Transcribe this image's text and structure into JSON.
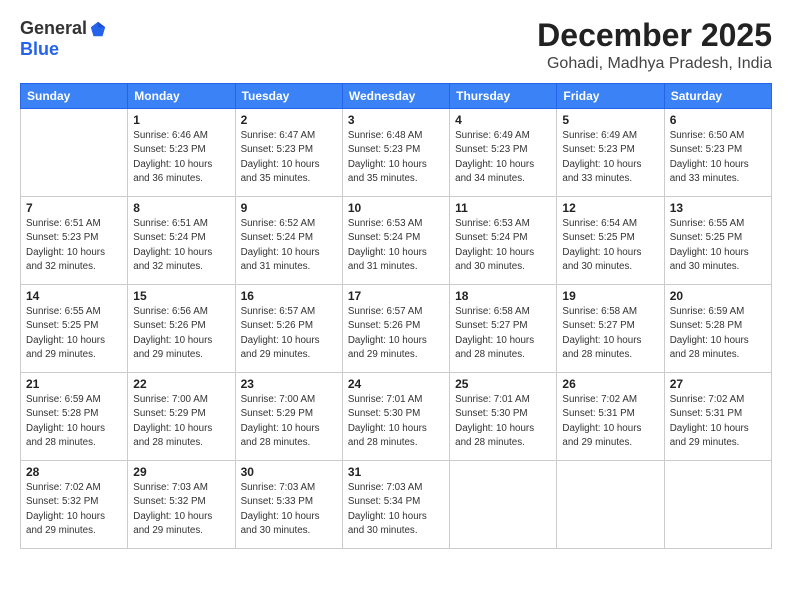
{
  "logo": {
    "general": "General",
    "blue": "Blue"
  },
  "title": "December 2025",
  "subtitle": "Gohadi, Madhya Pradesh, India",
  "days_header": [
    "Sunday",
    "Monday",
    "Tuesday",
    "Wednesday",
    "Thursday",
    "Friday",
    "Saturday"
  ],
  "weeks": [
    [
      {
        "day": "",
        "info": ""
      },
      {
        "day": "1",
        "info": "Sunrise: 6:46 AM\nSunset: 5:23 PM\nDaylight: 10 hours\nand 36 minutes."
      },
      {
        "day": "2",
        "info": "Sunrise: 6:47 AM\nSunset: 5:23 PM\nDaylight: 10 hours\nand 35 minutes."
      },
      {
        "day": "3",
        "info": "Sunrise: 6:48 AM\nSunset: 5:23 PM\nDaylight: 10 hours\nand 35 minutes."
      },
      {
        "day": "4",
        "info": "Sunrise: 6:49 AM\nSunset: 5:23 PM\nDaylight: 10 hours\nand 34 minutes."
      },
      {
        "day": "5",
        "info": "Sunrise: 6:49 AM\nSunset: 5:23 PM\nDaylight: 10 hours\nand 33 minutes."
      },
      {
        "day": "6",
        "info": "Sunrise: 6:50 AM\nSunset: 5:23 PM\nDaylight: 10 hours\nand 33 minutes."
      }
    ],
    [
      {
        "day": "7",
        "info": "Sunrise: 6:51 AM\nSunset: 5:23 PM\nDaylight: 10 hours\nand 32 minutes."
      },
      {
        "day": "8",
        "info": "Sunrise: 6:51 AM\nSunset: 5:24 PM\nDaylight: 10 hours\nand 32 minutes."
      },
      {
        "day": "9",
        "info": "Sunrise: 6:52 AM\nSunset: 5:24 PM\nDaylight: 10 hours\nand 31 minutes."
      },
      {
        "day": "10",
        "info": "Sunrise: 6:53 AM\nSunset: 5:24 PM\nDaylight: 10 hours\nand 31 minutes."
      },
      {
        "day": "11",
        "info": "Sunrise: 6:53 AM\nSunset: 5:24 PM\nDaylight: 10 hours\nand 30 minutes."
      },
      {
        "day": "12",
        "info": "Sunrise: 6:54 AM\nSunset: 5:25 PM\nDaylight: 10 hours\nand 30 minutes."
      },
      {
        "day": "13",
        "info": "Sunrise: 6:55 AM\nSunset: 5:25 PM\nDaylight: 10 hours\nand 30 minutes."
      }
    ],
    [
      {
        "day": "14",
        "info": "Sunrise: 6:55 AM\nSunset: 5:25 PM\nDaylight: 10 hours\nand 29 minutes."
      },
      {
        "day": "15",
        "info": "Sunrise: 6:56 AM\nSunset: 5:26 PM\nDaylight: 10 hours\nand 29 minutes."
      },
      {
        "day": "16",
        "info": "Sunrise: 6:57 AM\nSunset: 5:26 PM\nDaylight: 10 hours\nand 29 minutes."
      },
      {
        "day": "17",
        "info": "Sunrise: 6:57 AM\nSunset: 5:26 PM\nDaylight: 10 hours\nand 29 minutes."
      },
      {
        "day": "18",
        "info": "Sunrise: 6:58 AM\nSunset: 5:27 PM\nDaylight: 10 hours\nand 28 minutes."
      },
      {
        "day": "19",
        "info": "Sunrise: 6:58 AM\nSunset: 5:27 PM\nDaylight: 10 hours\nand 28 minutes."
      },
      {
        "day": "20",
        "info": "Sunrise: 6:59 AM\nSunset: 5:28 PM\nDaylight: 10 hours\nand 28 minutes."
      }
    ],
    [
      {
        "day": "21",
        "info": "Sunrise: 6:59 AM\nSunset: 5:28 PM\nDaylight: 10 hours\nand 28 minutes."
      },
      {
        "day": "22",
        "info": "Sunrise: 7:00 AM\nSunset: 5:29 PM\nDaylight: 10 hours\nand 28 minutes."
      },
      {
        "day": "23",
        "info": "Sunrise: 7:00 AM\nSunset: 5:29 PM\nDaylight: 10 hours\nand 28 minutes."
      },
      {
        "day": "24",
        "info": "Sunrise: 7:01 AM\nSunset: 5:30 PM\nDaylight: 10 hours\nand 28 minutes."
      },
      {
        "day": "25",
        "info": "Sunrise: 7:01 AM\nSunset: 5:30 PM\nDaylight: 10 hours\nand 28 minutes."
      },
      {
        "day": "26",
        "info": "Sunrise: 7:02 AM\nSunset: 5:31 PM\nDaylight: 10 hours\nand 29 minutes."
      },
      {
        "day": "27",
        "info": "Sunrise: 7:02 AM\nSunset: 5:31 PM\nDaylight: 10 hours\nand 29 minutes."
      }
    ],
    [
      {
        "day": "28",
        "info": "Sunrise: 7:02 AM\nSunset: 5:32 PM\nDaylight: 10 hours\nand 29 minutes."
      },
      {
        "day": "29",
        "info": "Sunrise: 7:03 AM\nSunset: 5:32 PM\nDaylight: 10 hours\nand 29 minutes."
      },
      {
        "day": "30",
        "info": "Sunrise: 7:03 AM\nSunset: 5:33 PM\nDaylight: 10 hours\nand 30 minutes."
      },
      {
        "day": "31",
        "info": "Sunrise: 7:03 AM\nSunset: 5:34 PM\nDaylight: 10 hours\nand 30 minutes."
      },
      {
        "day": "",
        "info": ""
      },
      {
        "day": "",
        "info": ""
      },
      {
        "day": "",
        "info": ""
      }
    ]
  ]
}
